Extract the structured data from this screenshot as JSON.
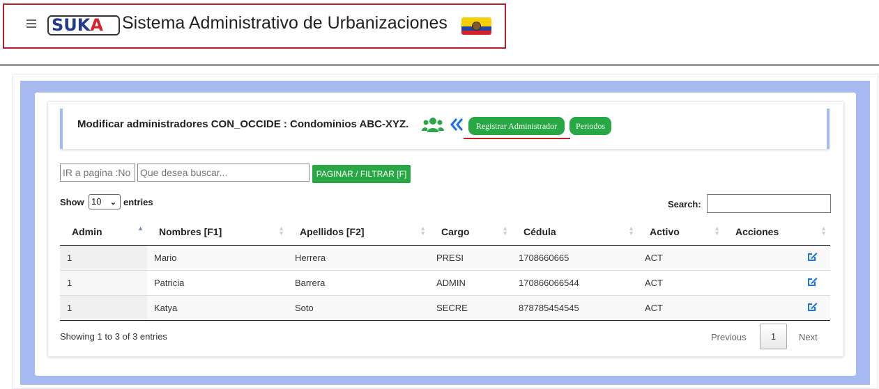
{
  "header": {
    "logo_text_main": "SUK",
    "logo_text_accent": "A",
    "title": "Sistema Administrativo de Urbanizaciones",
    "flag_icon": "ecuador-flag-icon"
  },
  "page": {
    "title": "Modificar administradores CON_OCCIDE : Condominios ABC-XYZ.",
    "register_button": "Registrar Administrador",
    "periods_button": "Periodos"
  },
  "filters": {
    "page_placeholder": "IR a pagina :No",
    "search_placeholder": "Que desea buscar...",
    "filter_button": "PAGINAR / FILTRAR [F]"
  },
  "table_controls": {
    "show_label": "Show",
    "entries_value": "10",
    "entries_label": "entries",
    "search_label": "Search:"
  },
  "table": {
    "columns": [
      "Admin",
      "Nombres [F1]",
      "Apellidos [F2]",
      "Cargo",
      "Cédula",
      "Activo",
      "Acciones"
    ],
    "rows": [
      {
        "admin": "1",
        "nombres": "Mario",
        "apellidos": "Herrera",
        "cargo": "PRESI",
        "cedula": "1708660665",
        "activo": "ACT"
      },
      {
        "admin": "1",
        "nombres": "Patricia",
        "apellidos": "Barrera",
        "cargo": "ADMIN",
        "cedula": "170866066544",
        "activo": "ACT"
      },
      {
        "admin": "1",
        "nombres": "Katya",
        "apellidos": "Soto",
        "cargo": "SECRE",
        "cedula": "878785454545",
        "activo": "ACT"
      }
    ]
  },
  "footer": {
    "showing": "Showing 1 to 3 of 3 entries",
    "previous": "Previous",
    "page": "1",
    "next": "Next"
  },
  "colors": {
    "accent_green": "#28a745",
    "panel_blue": "#a6b9f1",
    "edit_blue": "#1a73e8",
    "header_border_red": "#b21f2a"
  }
}
